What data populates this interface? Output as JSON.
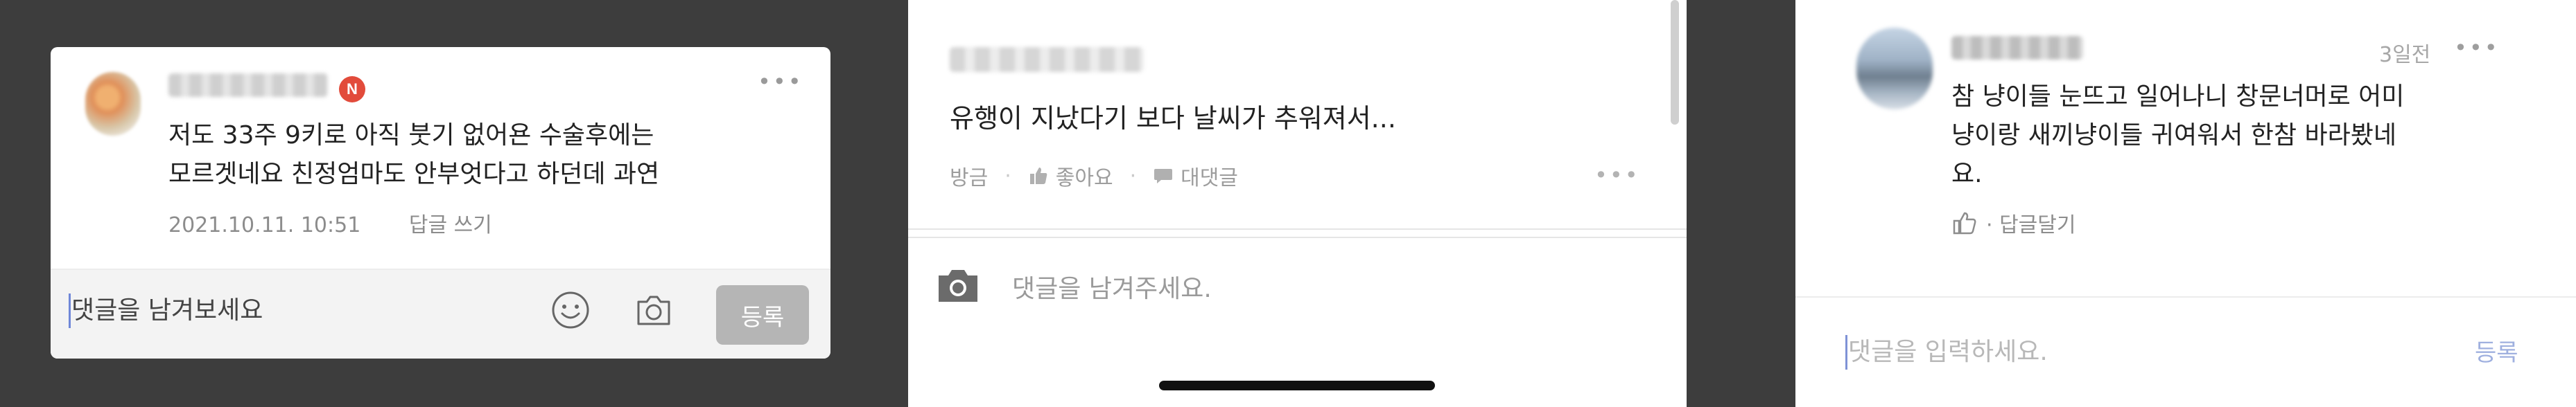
{
  "panel1": {
    "badge": "N",
    "comment_lines": [
      "저도 33주 9키로 아직 붓기 없어욘 수술후에는",
      "모르겟네요 친정엄마도 안부엇다고 하던데 과연"
    ],
    "timestamp": "2021.10.11. 10:51",
    "reply_label": "답글 쓰기",
    "input_placeholder": "댓글을 남겨보세요",
    "submit_label": "등록",
    "colors": {
      "badge": "#e24b3b",
      "submit_bg": "#b5b5b5"
    }
  },
  "panel2": {
    "comment": "유행이 지났다기 보다 날씨가 추워져서...",
    "time": "방금",
    "like_label": "좋아요",
    "reply_label": "대댓글",
    "input_placeholder": "댓글을 남겨주세요."
  },
  "panel3": {
    "time": "3일전",
    "comment_lines": [
      "참 냥이들 눈뜨고 일어나니 창문너머로 어미",
      "냥이랑 새끼냥이들 귀여워서 한참 바라봤네",
      "요."
    ],
    "reply_label": "· 답글달기",
    "input_placeholder": "댓글을 입력하세요.",
    "submit_label": "등록",
    "colors": {
      "submit_text": "#9fb0df"
    }
  }
}
